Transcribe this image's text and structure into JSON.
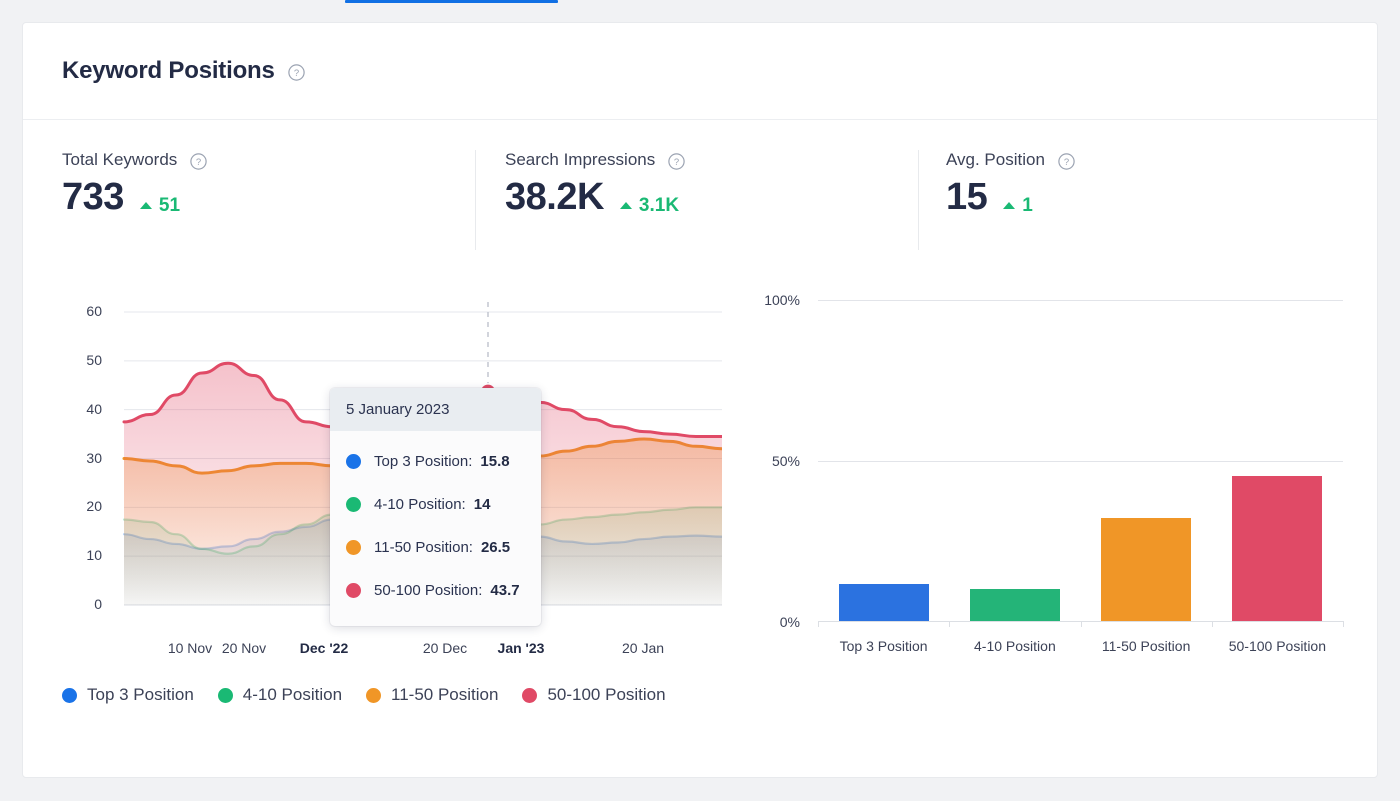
{
  "page": {
    "background": "#f1f2f4",
    "active_tab_underline_color": "#1170e4"
  },
  "header": {
    "title": "Keyword Positions",
    "help_icon": "question-circle-icon"
  },
  "metrics": [
    {
      "label": "Total Keywords",
      "value": "733",
      "delta": "51",
      "delta_direction": "up",
      "delta_color": "#1ab974",
      "help_icon": "question-circle-icon"
    },
    {
      "label": "Search Impressions",
      "value": "38.2K",
      "delta": "3.1K",
      "delta_direction": "up",
      "delta_color": "#1ab974",
      "help_icon": "question-circle-icon"
    },
    {
      "label": "Avg. Position",
      "value": "15",
      "delta": "1",
      "delta_direction": "up",
      "delta_color": "#1ab974",
      "help_icon": "question-circle-icon"
    }
  ],
  "legend": [
    {
      "label": "Top 3 Position",
      "color": "#1a73e8"
    },
    {
      "label": "4-10 Position",
      "color": "#1ab974"
    },
    {
      "label": "11-50 Position",
      "color": "#f09627"
    },
    {
      "label": "50-100 Position",
      "color": "#e04a66"
    }
  ],
  "tooltip": {
    "date": "5 January 2023",
    "rows": [
      {
        "label": "Top 3 Position:",
        "value": "15.8",
        "color": "#1a73e8"
      },
      {
        "label": "4-10 Position:",
        "value": "14",
        "color": "#1ab974"
      },
      {
        "label": "11-50 Position:",
        "value": "26.5",
        "color": "#1ab974_x"
      },
      {
        "label": "50-100 Position:",
        "value": "43.7",
        "color": "#e04a66"
      }
    ]
  },
  "chart_data": [
    {
      "type": "area",
      "id": "keyword-positions-over-time",
      "title": "",
      "xlabel": "",
      "ylabel": "",
      "ylim": [
        0,
        60
      ],
      "yticks": [
        0,
        10,
        20,
        30,
        40,
        50,
        60
      ],
      "grid": true,
      "legend_position": "bottom-left",
      "xticks": [
        "10 Nov",
        "20 Nov",
        "Dec '22",
        "20 Dec",
        "Jan '23",
        "20 Jan"
      ],
      "xticks_bold": [
        "Dec '22",
        "Jan '23"
      ],
      "hover": {
        "x_label": "Jan '23",
        "date": "5 January 2023",
        "line_style": "dashed"
      },
      "series": [
        {
          "name": "Top 3 Position",
          "color": "#1a73e8",
          "dimmed": true,
          "values": [
            14.5,
            13.5,
            12.5,
            11.5,
            12,
            13.5,
            15,
            16,
            17.5,
            18.5,
            18,
            17,
            16,
            15.5,
            15.8,
            15,
            14,
            13,
            12.5,
            12.8,
            13.5,
            14,
            14.2,
            14
          ]
        },
        {
          "name": "4-10 Position",
          "color": "#1ab974",
          "dimmed": true,
          "values": [
            17.5,
            17,
            14.5,
            11.5,
            10.5,
            12,
            14.5,
            16.5,
            18.5,
            19,
            17.5,
            16,
            15,
            14.2,
            14,
            15,
            16.5,
            17.5,
            18,
            18.5,
            19,
            19.5,
            20,
            20
          ]
        },
        {
          "name": "11-50 Position",
          "color": "#f09627",
          "dimmed": false,
          "values": [
            30,
            29.5,
            28.5,
            27,
            27.5,
            28.5,
            29,
            29,
            28.5,
            27.5,
            26.5,
            27.5,
            30.5,
            32,
            26.5,
            29,
            30.5,
            31.5,
            32.5,
            33.5,
            34,
            33.5,
            32.5,
            32
          ]
        },
        {
          "name": "50-100 Position",
          "color": "#e04a66",
          "dimmed": false,
          "values": [
            37.5,
            39,
            43,
            47.5,
            49.5,
            47,
            42,
            37.5,
            36.5,
            36,
            35.5,
            35,
            35.5,
            36.5,
            43.7,
            42.5,
            41.5,
            40,
            38,
            36.5,
            35.5,
            35,
            34.5,
            34.5
          ]
        }
      ]
    },
    {
      "type": "bar",
      "id": "keyword-positions-distribution",
      "title": "",
      "xlabel": "",
      "ylabel": "",
      "ylim": [
        0,
        100
      ],
      "yticks": [
        "0%",
        "50%",
        "100%"
      ],
      "grid": true,
      "categories": [
        "Top 3 Position",
        "4-10 Position",
        "11-50 Position",
        "50-100 Position"
      ],
      "values": [
        11.8,
        10.1,
        32.3,
        45.2
      ],
      "colors": [
        "#2b72e0",
        "#24b478",
        "#f09627",
        "#e04a66"
      ]
    }
  ]
}
